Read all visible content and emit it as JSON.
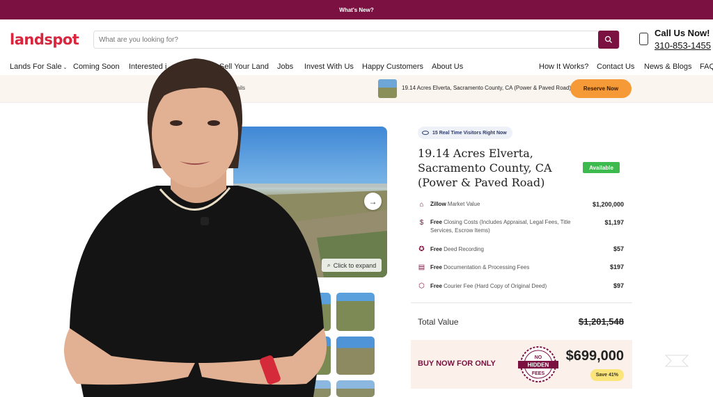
{
  "topbar": {
    "label": "What's New?"
  },
  "header": {
    "logo": "landspot",
    "search_placeholder": "What are you looking for?",
    "call_title": "Call Us Now!",
    "call_number": "310-853-1455"
  },
  "nav": {
    "items": [
      "Lands For Sale",
      "Coming Soon",
      "Interested i",
      "Sell Your Land",
      "Jobs",
      "Invest With Us",
      "Happy Customers",
      "About Us",
      "How It Works?",
      "Contact Us",
      "News & Blogs",
      "FAQ"
    ]
  },
  "subbar": {
    "details_fragment": "ails",
    "property_short": "19.14 Acres Elverta, Sacramento County, CA (Power & Paved Road)",
    "reserve_label": "Reserve Now"
  },
  "gallery": {
    "expand_label": "Click to expand"
  },
  "listing": {
    "visitors": "15 Real Time Visitors Right Now",
    "title": "19.14 Acres Elverta, Sacramento County, CA (Power & Paved Road)",
    "status": "Available",
    "fees": [
      {
        "icon": "zillow-icon",
        "bold": "Zillow",
        "text": "Market Value",
        "value": "$1,200,000"
      },
      {
        "icon": "dollar-icon",
        "bold": "Free",
        "text": "Closing Costs (Includes Appraisal, Legal Fees, Title Services, Escrow Items)",
        "value": "$1,197"
      },
      {
        "icon": "award-icon",
        "bold": "Free",
        "text": "Deed Recording",
        "value": "$57"
      },
      {
        "icon": "document-icon",
        "bold": "Free",
        "text": "Documentation & Processing Fees",
        "value": "$197"
      },
      {
        "icon": "package-icon",
        "bold": "Free",
        "text": "Courier Fee (Hard Copy of Original Deed)",
        "value": "$97"
      }
    ],
    "total_label": "Total Value",
    "total_value": "$1,201,548",
    "buy_label": "BUY NOW FOR ONLY",
    "seal_lines": [
      "NO",
      "HIDDEN",
      "FEES"
    ],
    "price": "$699,000",
    "save": "Save 41%"
  },
  "colors": {
    "brand": "#7a1140",
    "accent": "#f59a36",
    "available": "#3dba4e"
  }
}
